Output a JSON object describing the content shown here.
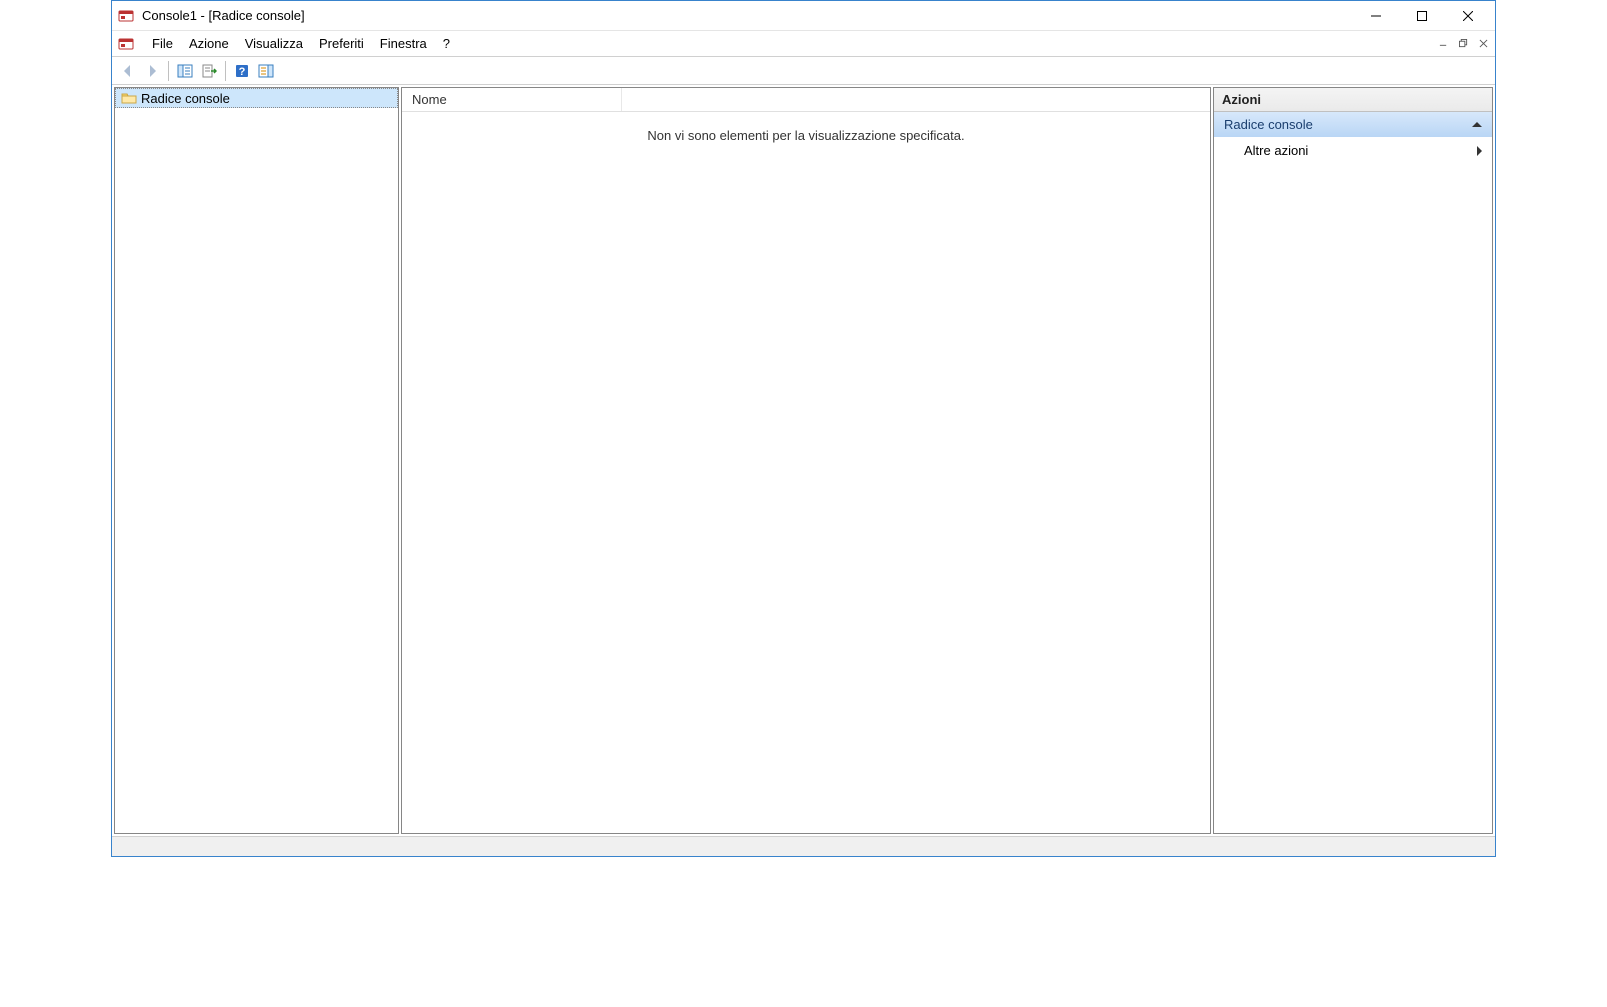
{
  "title": "Console1 - [Radice console]",
  "menu": {
    "file": "File",
    "azione": "Azione",
    "visualizza": "Visualizza",
    "preferiti": "Preferiti",
    "finestra": "Finestra",
    "help": "?"
  },
  "tree": {
    "root_label": "Radice console"
  },
  "list": {
    "col_name": "Nome",
    "empty_text": "Non vi sono elementi per la visualizzazione specificata."
  },
  "actions": {
    "header": "Azioni",
    "group_title": "Radice console",
    "more_actions": "Altre azioni"
  }
}
